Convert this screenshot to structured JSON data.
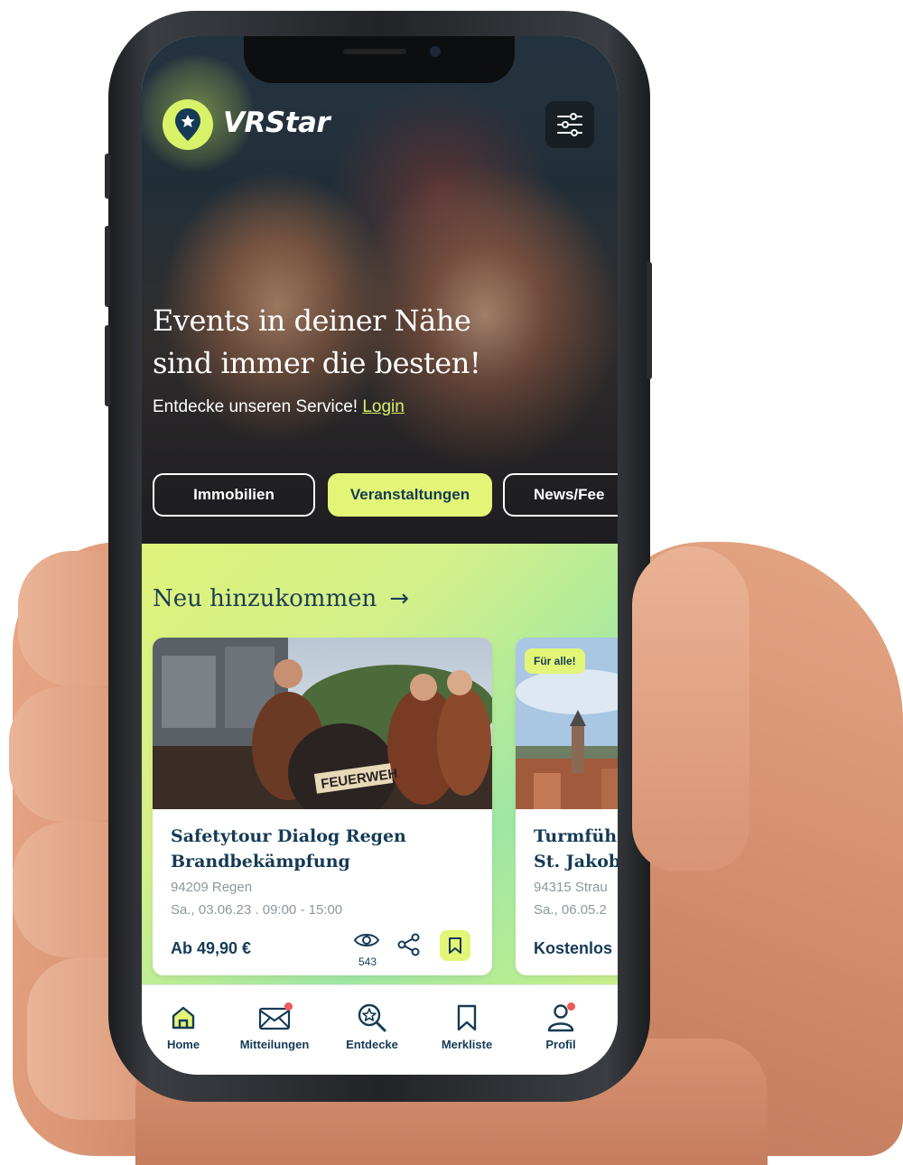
{
  "app": {
    "name": "VRStar"
  },
  "hero": {
    "headline_line1": "Events in deiner Nähe",
    "headline_line2": "sind immer die besten!",
    "subline": "Entdecke unseren Service!",
    "login_label": "Login"
  },
  "categories": [
    {
      "label": "Immobilien",
      "active": false
    },
    {
      "label": "Veranstaltungen",
      "active": true
    },
    {
      "label": "News/Fee",
      "active": false
    }
  ],
  "section": {
    "title": "Neu hinzukommen",
    "arrow": "→"
  },
  "cards": [
    {
      "title_line1": "Safetytour Dialog Regen",
      "title_line2": "Brandbekämpfung",
      "location": "94209 Regen",
      "date": "Sa., 03.06.23 . 09:00 - 15:00",
      "price": "Ab 49,90 €",
      "views": "543",
      "image_label": "FEUERWEH"
    },
    {
      "badge": "Für alle!",
      "title_line1": "Turmfüh",
      "title_line2": "St. Jakob",
      "location": "94315 Strau",
      "date": "Sa., 06.05.2",
      "price": "Kostenlos"
    }
  ],
  "nav": [
    {
      "label": "Home",
      "icon": "home-icon"
    },
    {
      "label": "Mitteilungen",
      "icon": "mail-icon"
    },
    {
      "label": "Entdecke",
      "icon": "discover-icon"
    },
    {
      "label": "Merkliste",
      "icon": "bookmark-icon"
    },
    {
      "label": "Profil",
      "icon": "profile-icon"
    }
  ],
  "colors": {
    "accent": "#e3f576",
    "primary_text": "#163a55",
    "notification_dot": "#f0595a"
  }
}
